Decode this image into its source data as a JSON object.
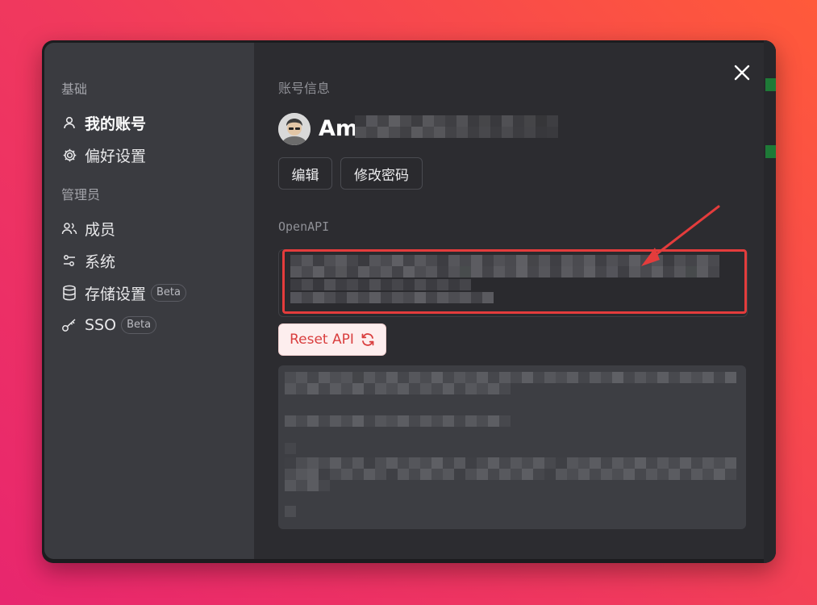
{
  "sidebar": {
    "section_basic": "基础",
    "section_admin": "管理员",
    "items": [
      {
        "label": "我的账号",
        "icon": "user-icon",
        "active": true
      },
      {
        "label": "偏好设置",
        "icon": "gear-icon"
      },
      {
        "label": "成员",
        "icon": "users-icon"
      },
      {
        "label": "系统",
        "icon": "sliders-icon"
      },
      {
        "label": "存储设置",
        "icon": "database-icon",
        "badge": "Beta"
      },
      {
        "label": "SSO",
        "icon": "key-icon",
        "badge": "Beta"
      }
    ]
  },
  "main": {
    "title": "账号信息",
    "username": "Am",
    "edit_label": "编辑",
    "change_password_label": "修改密码",
    "openapi_label": "OpenAPI",
    "reset_label": "Reset API"
  },
  "colors": {
    "accent_red": "#e43c3c",
    "sidebar_bg": "#3a3b40",
    "panel_bg": "#2c2c30"
  }
}
